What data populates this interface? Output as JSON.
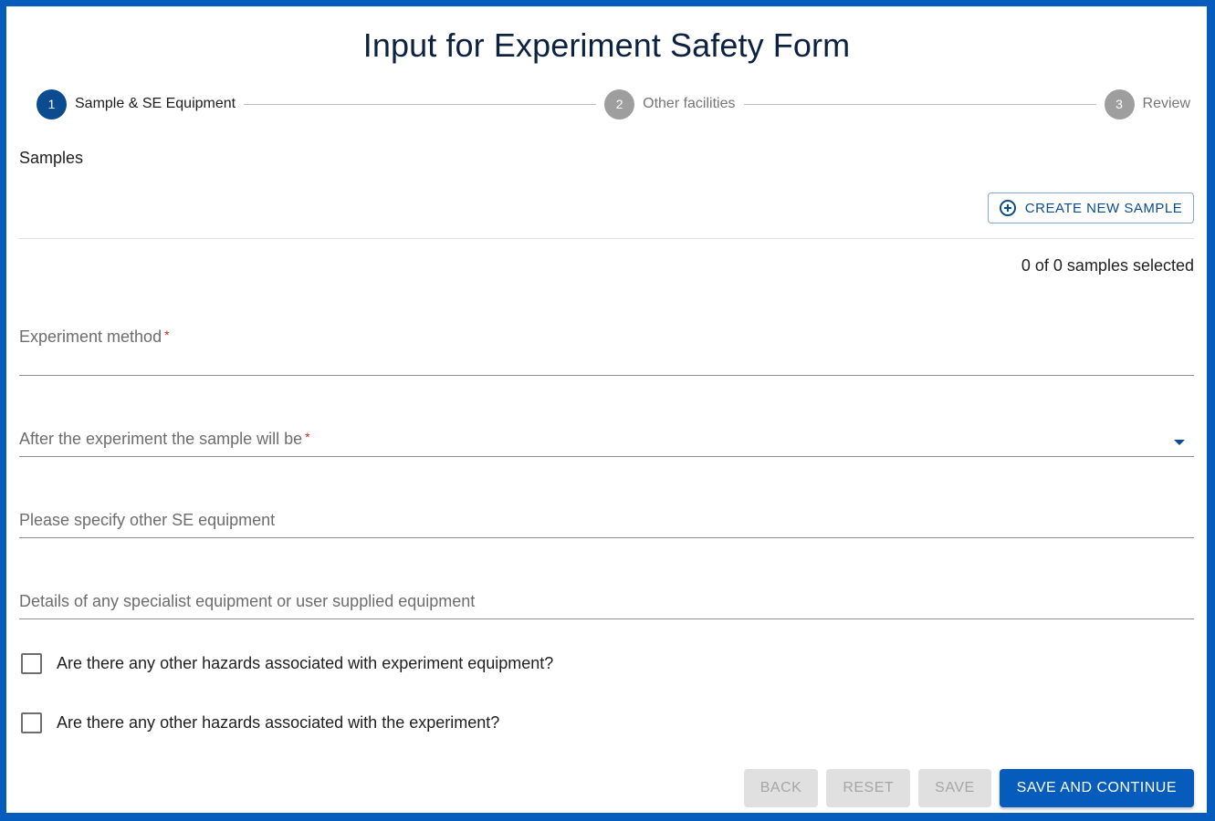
{
  "page": {
    "title": "Input for Experiment Safety Form",
    "colors": {
      "accent": "#055cbc",
      "step_active": "#0b4b8f",
      "step_inactive": "#9e9e9e",
      "required": "#c62828"
    }
  },
  "stepper": {
    "steps": [
      {
        "number": "1",
        "label": "Sample & SE Equipment",
        "state": "active"
      },
      {
        "number": "2",
        "label": "Other facilities",
        "state": "inactive"
      },
      {
        "number": "3",
        "label": "Review",
        "state": "inactive"
      }
    ]
  },
  "samples": {
    "section_label": "Samples",
    "create_button_label": "CREATE NEW SAMPLE",
    "create_button_icon": "add-circle-outline-icon",
    "selected_count_text": "0 of 0 samples selected"
  },
  "fields": {
    "experiment_method": {
      "label": "Experiment method",
      "required_mark": "*",
      "value": ""
    },
    "sample_after_experiment": {
      "label": "After the experiment the sample will be",
      "required_mark": "*",
      "selected_value": "",
      "icon": "arrow-drop-down-icon"
    },
    "other_se_equipment": {
      "label": "Please specify other SE equipment",
      "value": ""
    },
    "specialist_equipment": {
      "label": "Details of any specialist equipment or user supplied equipment",
      "value": ""
    }
  },
  "checkboxes": [
    {
      "label": "Are there any other hazards associated with experiment equipment?",
      "checked": false
    },
    {
      "label": "Are there any other hazards associated with the experiment?",
      "checked": false
    }
  ],
  "footer": {
    "back_label": "BACK",
    "reset_label": "RESET",
    "save_label": "SAVE",
    "save_continue_label": "SAVE AND CONTINUE"
  }
}
